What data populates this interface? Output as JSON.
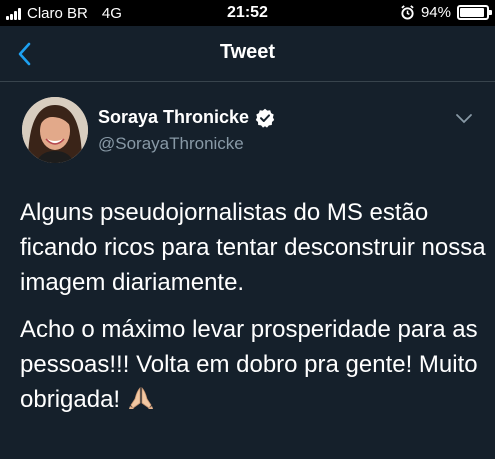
{
  "status_bar": {
    "carrier": "Claro BR",
    "network": "4G",
    "time": "21:52",
    "battery_percent": "94%",
    "battery_level": 0.94
  },
  "nav": {
    "title": "Tweet",
    "back_icon": "chevron-left-icon"
  },
  "tweet": {
    "author_name": "Soraya Thronicke",
    "author_handle": "@SorayaThronicke",
    "verified": true,
    "paragraphs": [
      "Alguns pseudojornalistas do MS estão ficando ricos para tentar desconstruir nossa imagem diariamente.",
      "Acho o máximo levar prosperidade para as pessoas!!! Volta em dobro pra gente! Muito obrigada!"
    ],
    "trailing_emoji": "folded-hands-icon"
  },
  "colors": {
    "background": "#15202b",
    "accent": "#1da1f2",
    "secondary_text": "#8899a6",
    "divider": "#38444d"
  }
}
